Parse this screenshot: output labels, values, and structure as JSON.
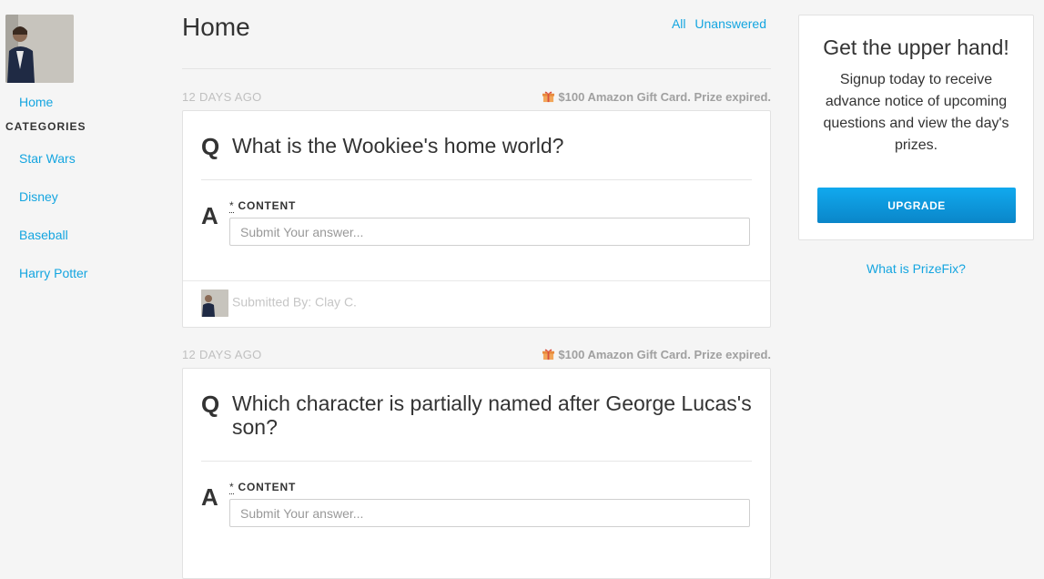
{
  "sidebar": {
    "home_label": "Home",
    "categories_title": "CATEGORIES",
    "categories": [
      "Star Wars",
      "Disney",
      "Baseball",
      "Harry Potter"
    ]
  },
  "main": {
    "title": "Home",
    "filters": {
      "all": "All",
      "unanswered": "Unanswered"
    },
    "questions": [
      {
        "date": "12 DAYS AGO",
        "prize": "$100 Amazon Gift Card. Prize expired.",
        "q_letter": "Q",
        "text": "What is the Wookiee's home world?",
        "a_letter": "A",
        "required_mark": "*",
        "content_label": "CONTENT",
        "placeholder": "Submit Your answer...",
        "submitted_by": "Submitted By: Clay C."
      },
      {
        "date": "12 DAYS AGO",
        "prize": "$100 Amazon Gift Card. Prize expired.",
        "q_letter": "Q",
        "text": "Which character is partially named after George Lucas's son?",
        "a_letter": "A",
        "required_mark": "*",
        "content_label": "CONTENT",
        "placeholder": "Submit Your answer..."
      }
    ]
  },
  "promo": {
    "title": "Get the upper hand!",
    "text": "Signup today to receive advance notice of upcoming questions and view the day's prizes.",
    "button": "UPGRADE",
    "link": "What is PrizeFix?"
  },
  "colors": {
    "link": "#14a5e0",
    "button": "#0a96d8",
    "muted": "#c0c0c0"
  },
  "icons": {
    "prize": "gift-icon"
  }
}
